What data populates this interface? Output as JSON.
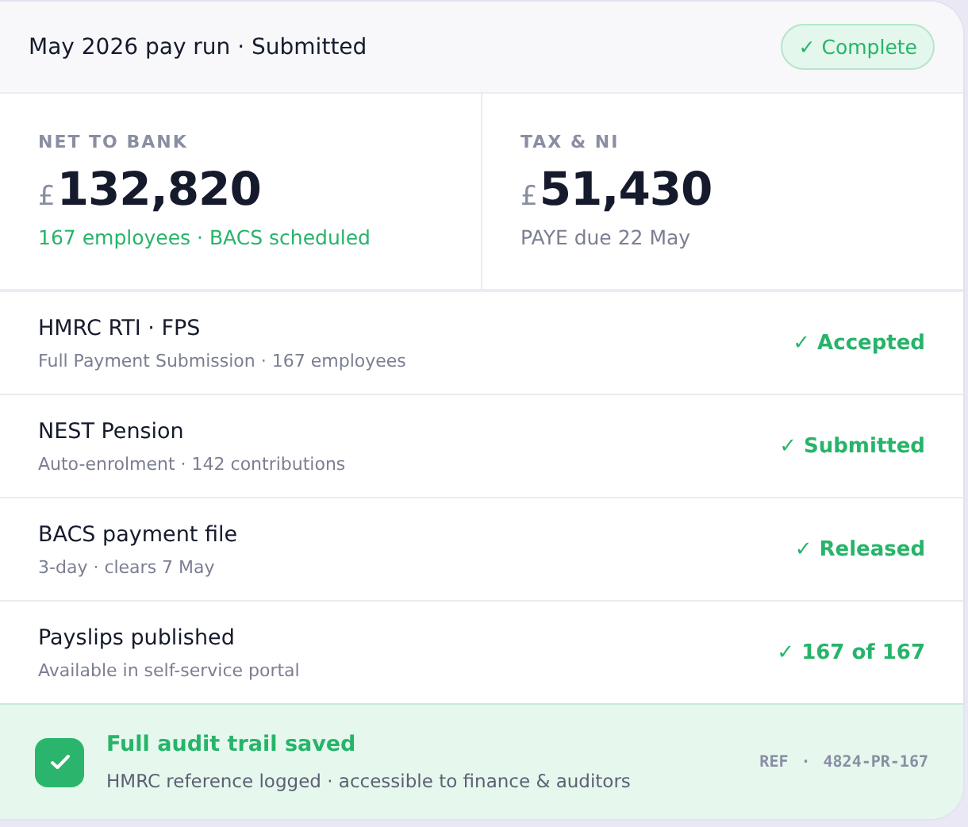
{
  "header": {
    "title": "May 2026 pay run · Submitted",
    "badge": "✓ Complete"
  },
  "stats": [
    {
      "label": "NET TO BANK",
      "currency": "£",
      "amount": "132,820",
      "note": "167 employees · BACS scheduled",
      "color": "#27b46a"
    },
    {
      "label": "TAX & NI",
      "currency": "£",
      "amount": "51,430",
      "note": "PAYE due 22 May",
      "color": "#7b7f91"
    }
  ],
  "rows": [
    {
      "title": "HMRC RTI · FPS",
      "subtitle": "Full Payment Submission · 167 employees",
      "status": "✓ Accepted"
    },
    {
      "title": "NEST Pension",
      "subtitle": "Auto-enrolment · 142 contributions",
      "status": "✓ Submitted"
    },
    {
      "title": "BACS payment file",
      "subtitle": "3-day · clears 7 May",
      "status": "✓ Released"
    },
    {
      "title": "Payslips published",
      "subtitle": "Available in self-service portal",
      "status": "✓ 167 of 167"
    }
  ],
  "footer": {
    "checked": true,
    "title": "Full audit trail saved",
    "subtitle": "HMRC reference logged · accessible to finance & auditors",
    "ref_label": "REF",
    "ref_separator": "·",
    "ref_value": "4824-PR-167"
  }
}
